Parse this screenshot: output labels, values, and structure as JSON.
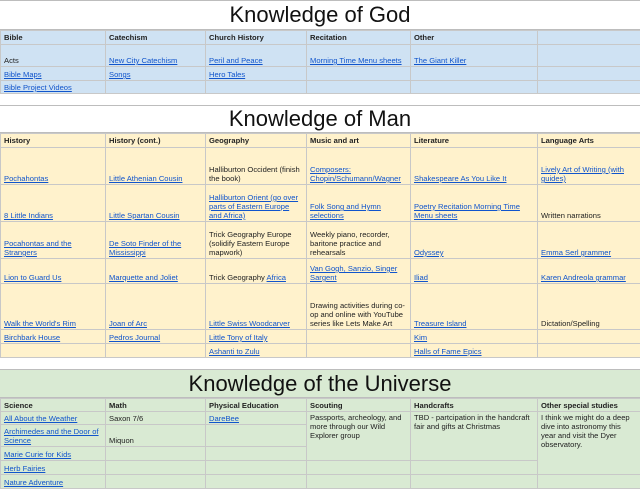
{
  "god": {
    "title": "Knowledge of God",
    "headers": [
      "Bible",
      "Catechism",
      "Church History",
      "Recitation",
      "Other",
      ""
    ],
    "rows": [
      [
        "Acts",
        "New City Catechism",
        "Peril and Peace",
        "Morning Time Menu sheets",
        "The Giant Killer",
        ""
      ],
      [
        "Bible Maps",
        "Songs",
        "Hero Tales",
        "",
        "",
        ""
      ],
      [
        "Bible Project Videos",
        "",
        "",
        "",
        "",
        ""
      ]
    ]
  },
  "man": {
    "title": "Knowledge of Man",
    "headers": [
      "History",
      "History (cont.)",
      "Geography",
      "Music and art",
      "Literature",
      "Language Arts"
    ],
    "rows": [
      [
        "Pochahontas",
        "Little Athenian Cousin",
        "Halliburton Occident (finish the book)",
        "Composers: Chopin/Schumann/Wagner",
        "Shakespeare As You Like It",
        "Lively Art of Writing (with guides)"
      ],
      [
        "8 Little Indians",
        "Little Spartan Cousin",
        "Halliburton Orient (go over parts of Eastern Europe and Africa)",
        "Folk Song and Hymn selections",
        "Poetry Recitation Morning Time Menu sheets",
        "Written narrations"
      ],
      [
        "Pocahontas and the Strangers",
        "De Soto Finder of the Mississippi",
        "Trick Geography Europe (solidify Eastern Europe mapwork)",
        "Weekly piano, recorder, baritone practice and rehearsals",
        "Odyssey",
        "Emma Serl grammer"
      ],
      [
        "Lion to Guard Us",
        "Marquette and Joliet",
        "Trick Geography Africa",
        "Van Gogh, Sanzio, Singer Sargent",
        "Iliad",
        "Karen Andreola grammar"
      ],
      [
        "Walk the World's Rim",
        "Joan of Arc",
        "Little Swiss Woodcarver",
        "Drawing activities during co-op and online with YouTube series like Lets Make Art",
        "Treasure Island",
        "Dictation/Spelling"
      ],
      [
        "Birchbark House",
        "Pedros Journal",
        "Little Tony of Italy",
        "",
        "Kim",
        ""
      ],
      [
        "",
        "",
        "Ashanti to Zulu",
        "",
        "Halls of Fame Epics",
        ""
      ]
    ]
  },
  "universe": {
    "title": "Knowledge of the Universe",
    "headers": [
      "Science",
      "Math",
      "Physical Education",
      "Scouting",
      "Handcrafts",
      "Other special studies"
    ],
    "rows": [
      [
        "All About the Weather",
        "Saxon 7/6",
        "DareBee",
        "Passports, archeology, and more through our Wild Explorer group",
        "TBD - partcipation in the handcraft fair and gifts at Christmas",
        "I think we might do a deep dive into astronomy this year and visit the Dyer observatory."
      ],
      [
        "Archimedes and the Door of Science",
        "Miquon",
        "",
        "",
        "",
        ""
      ],
      [
        "Marie Curie for Kids",
        "",
        "",
        "",
        "",
        ""
      ],
      [
        "Herb Fairies",
        "",
        "",
        "",
        "",
        ""
      ],
      [
        "Nature Adventure",
        "",
        "",
        "",
        "",
        ""
      ]
    ]
  }
}
